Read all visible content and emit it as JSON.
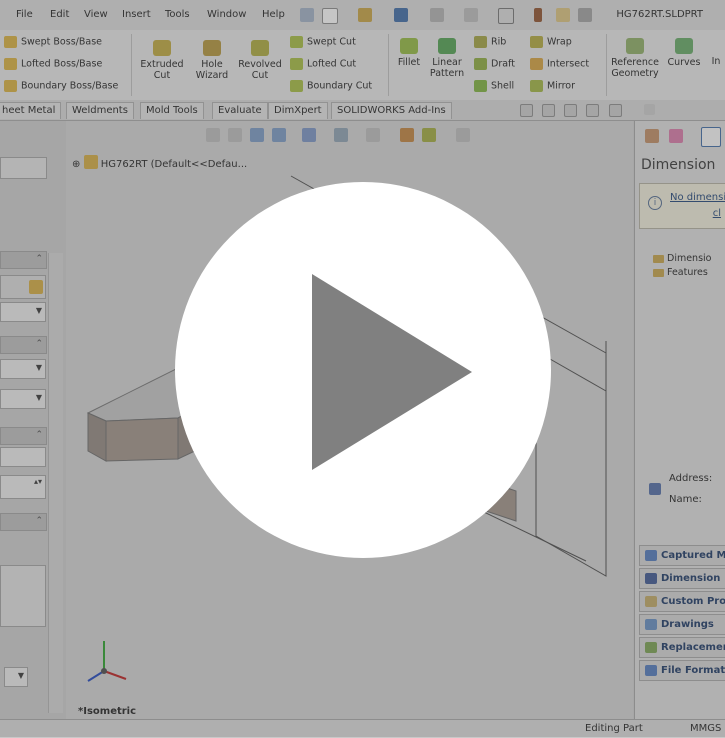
{
  "menubar": {
    "items": [
      "File",
      "Edit",
      "View",
      "Insert",
      "Tools",
      "Window",
      "Help"
    ],
    "filename": "HG762RT.SLDPRT"
  },
  "ribbon": {
    "group1": [
      "Swept Boss/Base",
      "Lofted Boss/Base",
      "Boundary Boss/Base"
    ],
    "extruded_cut": "Extruded\nCut",
    "hole_wizard": "Hole\nWizard",
    "revolved_cut": "Revolved\nCut",
    "group2": [
      "Swept Cut",
      "Lofted Cut",
      "Boundary Cut"
    ],
    "fillet": "Fillet",
    "linear_pattern": "Linear\nPattern",
    "group3": [
      "Rib",
      "Draft",
      "Shell"
    ],
    "group4": [
      "Wrap",
      "Intersect",
      "Mirror"
    ],
    "reference_geometry": "Reference\nGeometry",
    "curves": "Curves",
    "instant": "In"
  },
  "tabs": [
    "heet Metal",
    "Weldments",
    "Mold Tools",
    "Evaluate",
    "DimXpert",
    "SOLIDWORKS Add-Ins"
  ],
  "viewport": {
    "tree_head": "HG762RT  (Default<<Defau...",
    "view_label": "*Isometric"
  },
  "rightpanel": {
    "title": "Dimension",
    "info_text": "No dimensi",
    "info_sub": "cl",
    "tree": [
      "Dimensio",
      "Features"
    ],
    "address_label": "Address:",
    "name_label": "Name:",
    "buttons": [
      "Captured M",
      "Dimension",
      "Custom Pro",
      "Drawings",
      "Replacemen",
      "File Format"
    ]
  },
  "statusbar": {
    "text": "Editing Part",
    "unit": "MMGS"
  },
  "overlay": {
    "icon": "play-icon"
  },
  "colors": {
    "play_button": "#ffffff",
    "play_triangle": "#808080",
    "link": "#33507a",
    "part_body": "#9a8f87"
  }
}
